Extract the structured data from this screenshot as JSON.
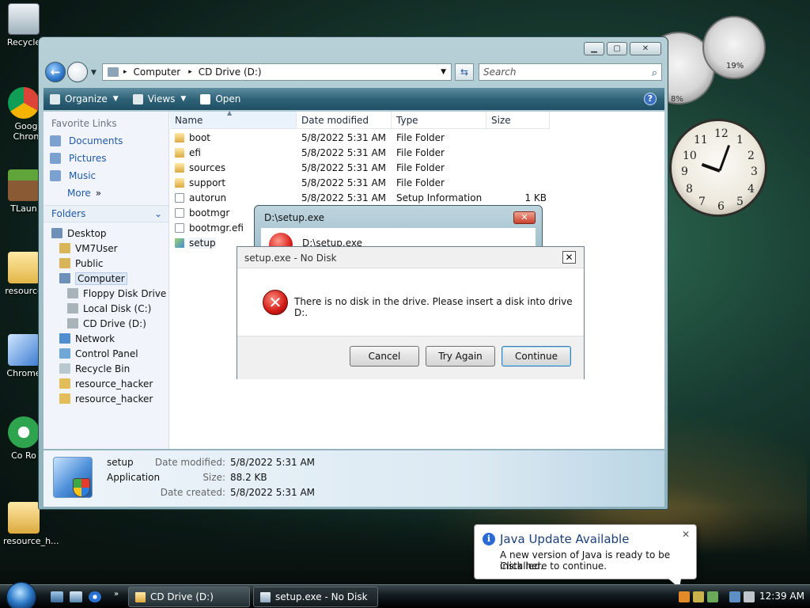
{
  "desktop": {
    "icons": [
      {
        "label": "Recycle"
      },
      {
        "label": "Goog Chron"
      },
      {
        "label": "TLaun"
      },
      {
        "label": "resource"
      },
      {
        "label": "Chrome"
      },
      {
        "label": "Co Ro"
      },
      {
        "label": "resource_h..."
      }
    ]
  },
  "explorer": {
    "address": {
      "crumbs": [
        "Computer",
        "CD Drive (D:)"
      ]
    },
    "search_placeholder": "Search",
    "toolbar": {
      "organize": "Organize",
      "views": "Views",
      "open": "Open"
    },
    "nav": {
      "favorite_heading": "Favorite Links",
      "favorites": [
        "Documents",
        "Pictures",
        "Music"
      ],
      "more": "More",
      "folders_heading": "Folders",
      "tree": [
        {
          "label": "Desktop",
          "indent": 0
        },
        {
          "label": "VM7User",
          "indent": 1
        },
        {
          "label": "Public",
          "indent": 1
        },
        {
          "label": "Computer",
          "indent": 1,
          "selected": true
        },
        {
          "label": "Floppy Disk Drive (A",
          "indent": 2
        },
        {
          "label": "Local Disk (C:)",
          "indent": 2
        },
        {
          "label": "CD Drive (D:)",
          "indent": 2
        },
        {
          "label": "Network",
          "indent": 1
        },
        {
          "label": "Control Panel",
          "indent": 1
        },
        {
          "label": "Recycle Bin",
          "indent": 1
        },
        {
          "label": "resource_hacker",
          "indent": 1
        },
        {
          "label": "resource_hacker",
          "indent": 1
        }
      ]
    },
    "columns": [
      "Name",
      "Date modified",
      "Type",
      "Size"
    ],
    "files": [
      {
        "name": "boot",
        "date": "5/8/2022 5:31 AM",
        "type": "File Folder",
        "size": ""
      },
      {
        "name": "efi",
        "date": "5/8/2022 5:31 AM",
        "type": "File Folder",
        "size": ""
      },
      {
        "name": "sources",
        "date": "5/8/2022 5:31 AM",
        "type": "File Folder",
        "size": ""
      },
      {
        "name": "support",
        "date": "5/8/2022 5:31 AM",
        "type": "File Folder",
        "size": ""
      },
      {
        "name": "autorun",
        "date": "5/8/2022 5:31 AM",
        "type": "Setup Information",
        "size": "1 KB"
      },
      {
        "name": "bootmgr",
        "date": "",
        "type": "",
        "size": ""
      },
      {
        "name": "bootmgr.efi",
        "date": "",
        "type": "",
        "size": ""
      },
      {
        "name": "setup",
        "date": "",
        "type": "",
        "size": ""
      }
    ],
    "details": {
      "name": "setup",
      "type": "Application",
      "date_modified_label": "Date modified:",
      "date_modified": "5/8/2022 5:31 AM",
      "size_label": "Size:",
      "size": "88.2 KB",
      "date_created_label": "Date created:",
      "date_created": "5/8/2022 5:31 AM"
    }
  },
  "dialog_back": {
    "title": "D:\\setup.exe",
    "message": "D:\\setup.exe"
  },
  "dialog": {
    "title": "setup.exe - No Disk",
    "message": "There is no disk in the drive. Please insert a disk into drive D:.",
    "buttons": {
      "cancel": "Cancel",
      "try_again": "Try Again",
      "continue": "Continue"
    }
  },
  "gadgets": {
    "cpu_value": "8%",
    "memory_value": "19%"
  },
  "balloon": {
    "title": "Java Update Available",
    "line1": "A new version of Java is ready to be installed.",
    "line2": "Click here to continue."
  },
  "taskbar": {
    "tasks": [
      {
        "label": "CD Drive (D:)"
      },
      {
        "label": "setup.exe - No Disk"
      }
    ],
    "clock": "12:39 AM"
  }
}
